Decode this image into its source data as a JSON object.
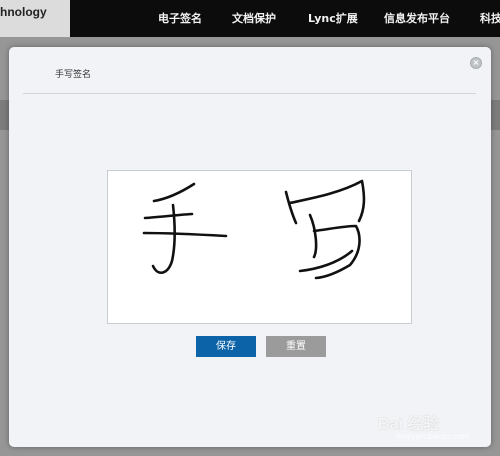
{
  "header": {
    "brand_text": "hnology",
    "nav": [
      {
        "label": "电子签名"
      },
      {
        "label": "文档保护"
      },
      {
        "label": "Lync扩展"
      },
      {
        "label": "信息发布平台"
      },
      {
        "label": "科技"
      }
    ]
  },
  "dialog": {
    "title": "手写签名",
    "close_icon": "close-icon",
    "signature_text": "手写",
    "buttons": {
      "save_label": "保存",
      "reset_label": "重置"
    }
  },
  "watermark": {
    "text": "Bai 经验",
    "sub": "jingyan.baidu.com"
  },
  "colors": {
    "topbar": "#0c0c0c",
    "save_button": "#0d63a8",
    "reset_button": "#9b9b9b",
    "ink": "#111111"
  }
}
